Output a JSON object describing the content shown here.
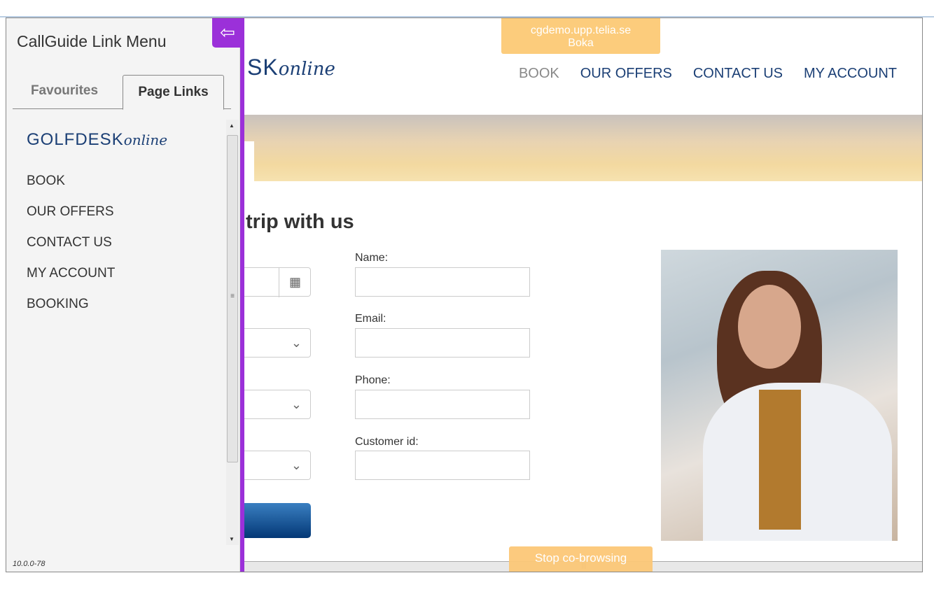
{
  "sidebar": {
    "title": "CallGuide Link Menu",
    "tabs": [
      {
        "label": "Favourites",
        "active": false
      },
      {
        "label": "Page Links",
        "active": true
      }
    ],
    "logo": {
      "main": "GOLFDESK",
      "script": "online"
    },
    "links": [
      "BOOK",
      "OUR OFFERS",
      "CONTACT US",
      "MY ACCOUNT",
      "BOOKING"
    ],
    "version": "10.0.0-78",
    "accent": "#9b30d9"
  },
  "cobrowse": {
    "host": "cgdemo.upp.telia.se",
    "page": "Boka",
    "stop_label": "Stop co-browsing"
  },
  "site": {
    "logo": {
      "main": "SK",
      "script": "online"
    },
    "nav": [
      {
        "label": "BOOK",
        "active": true
      },
      {
        "label": "OUR OFFERS"
      },
      {
        "label": "CONTACT US"
      },
      {
        "label": "MY ACCOUNT"
      }
    ],
    "heading": "trip with us",
    "form": {
      "name_label": "Name:",
      "email_label": "Email:",
      "phone_label": "Phone:",
      "customer_label": "Customer id:"
    }
  }
}
